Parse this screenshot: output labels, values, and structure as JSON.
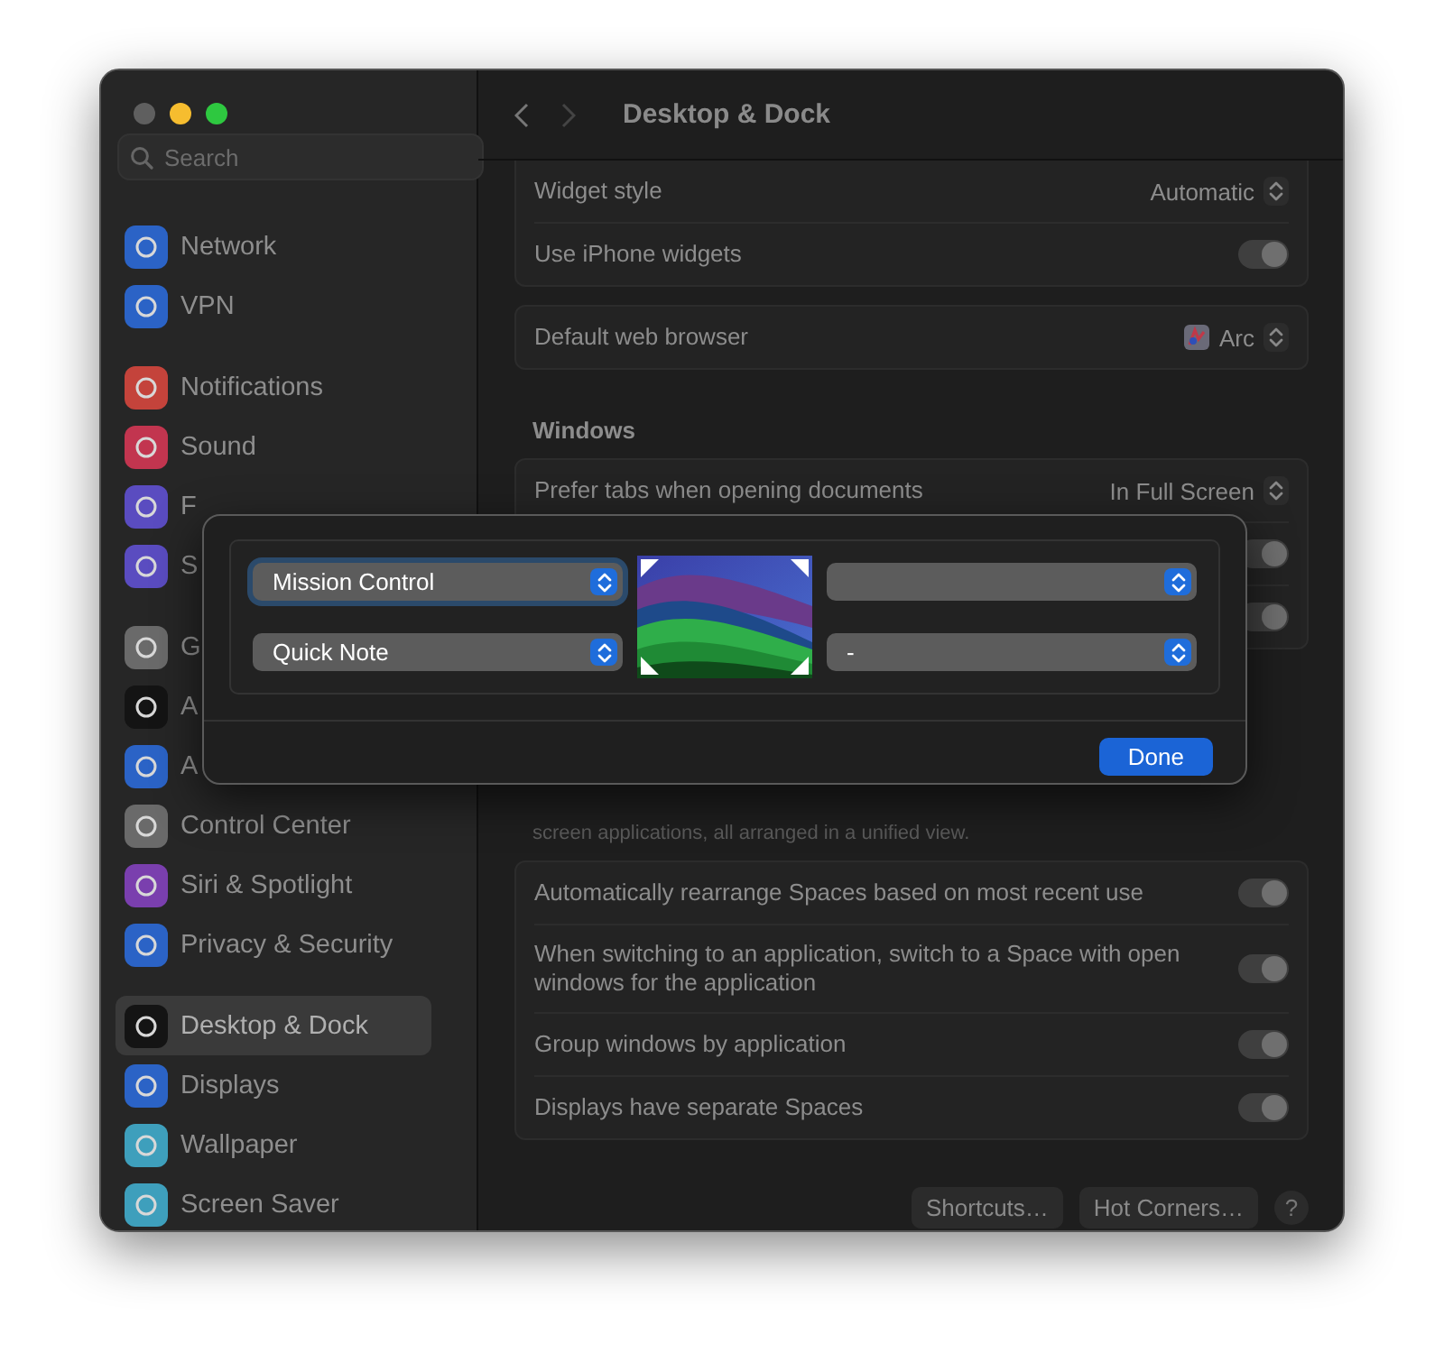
{
  "window": {
    "title": "Desktop & Dock"
  },
  "search": {
    "placeholder": "Search"
  },
  "sidebar": {
    "groups": [
      {
        "items": [
          {
            "label": "Network",
            "color": "#2b63c6",
            "selected": false
          },
          {
            "label": "VPN",
            "color": "#2b63c6",
            "selected": false
          }
        ]
      },
      {
        "items": [
          {
            "label": "Notifications",
            "color": "#c4433b",
            "selected": false
          },
          {
            "label": "Sound",
            "color": "#c2354f",
            "selected": false
          },
          {
            "label": "F",
            "color": "#5a4cc0",
            "selected": false
          },
          {
            "label": "S",
            "color": "#5a4cc0",
            "selected": false
          }
        ]
      },
      {
        "items": [
          {
            "label": "G",
            "color": "#6a6a6a",
            "selected": false
          },
          {
            "label": "A",
            "color": "#141414",
            "selected": false
          },
          {
            "label": "A",
            "color": "#2b63c6",
            "selected": false
          },
          {
            "label": "Control Center",
            "color": "#6a6a6a",
            "selected": false
          },
          {
            "label": "Siri & Spotlight",
            "color": "#7a3fae",
            "selected": false
          },
          {
            "label": "Privacy & Security",
            "color": "#2b63c6",
            "selected": false
          }
        ]
      },
      {
        "items": [
          {
            "label": "Desktop & Dock",
            "color": "#141414",
            "selected": true
          },
          {
            "label": "Displays",
            "color": "#2b63c6",
            "selected": false
          },
          {
            "label": "Wallpaper",
            "color": "#3e9fbc",
            "selected": false
          },
          {
            "label": "Screen Saver",
            "color": "#3e9fbc",
            "selected": false
          }
        ]
      }
    ]
  },
  "blocks": [
    {
      "kind": "card",
      "rows": [
        {
          "kind": "popup",
          "label": "Widget style",
          "value": "Automatic"
        },
        {
          "kind": "toggle",
          "label": "Use iPhone widgets",
          "on": true
        }
      ]
    },
    {
      "kind": "card",
      "rows": [
        {
          "kind": "browser",
          "label": "Default web browser",
          "value": "Arc"
        }
      ]
    },
    {
      "kind": "heading",
      "text": "Windows"
    },
    {
      "kind": "card",
      "rows": [
        {
          "kind": "popup",
          "label": "Prefer tabs when opening documents",
          "value": "In Full Screen"
        },
        {
          "kind": "toggle",
          "on": true
        },
        {
          "kind": "toggle",
          "on": true
        }
      ]
    },
    {
      "kind": "note",
      "text": "screen applications, all arranged in a unified view."
    },
    {
      "kind": "card",
      "rows": [
        {
          "kind": "toggle",
          "label": "Automatically rearrange Spaces based on most recent use",
          "on": true
        },
        {
          "kind": "toggle",
          "label": "When switching to an application, switch to a Space with open windows for the application",
          "on": true
        },
        {
          "kind": "toggle",
          "label": "Group windows by application",
          "on": true
        },
        {
          "kind": "toggle",
          "label": "Displays have separate Spaces",
          "on": true
        }
      ]
    }
  ],
  "footer_buttons": [
    "Shortcuts…",
    "Hot Corners…"
  ],
  "help": "?",
  "hot_corners": {
    "corners": [
      {
        "value": "Mission Control",
        "focused": true
      },
      {
        "focused": false
      },
      {
        "value": "Quick Note",
        "focused": false
      },
      {
        "value": "-",
        "focused": false
      }
    ],
    "done": "Done"
  }
}
